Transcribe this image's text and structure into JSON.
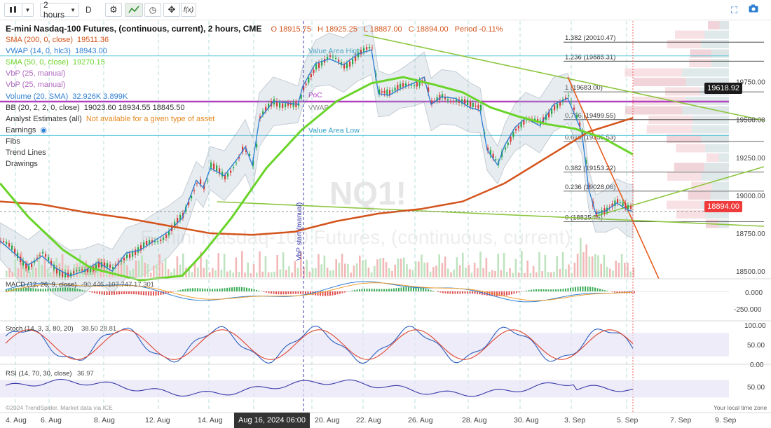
{
  "toolbar": {
    "interval": "2 hours",
    "d_label": "D"
  },
  "header": {
    "title": "E-mini Nasdaq-100 Futures, (continuous, current), 2 hours, CME",
    "open": "O 18915.75",
    "high": "H 18925.25",
    "low": "L 18887.00",
    "close": "C 18894.00",
    "period": "Period -0.11%"
  },
  "legend": [
    {
      "label": "SMA (200, 0, close)",
      "value": "19511.36",
      "color": "#d4541c"
    },
    {
      "label": "VWAP (14, 0, hlc3)",
      "value": "18943.00",
      "color": "#2d7dd2"
    },
    {
      "label": "SMA (50, 0, close)",
      "value": "19270.15",
      "color": "#6ad42a"
    },
    {
      "label": "VbP (25, manual)",
      "value": "",
      "color": "#b06bbf"
    },
    {
      "label": "VbP (25, manual)",
      "value": "",
      "color": "#b06bbf"
    },
    {
      "label": "Volume (20, SMA)",
      "value": "32.926K 3.899K",
      "color": "#2d7dd2"
    },
    {
      "label": "BB (20, 2, 2, 0, close)",
      "value": "19023.60 18934.55 18845.50",
      "color": "#333"
    },
    {
      "label": "Analyst Estimates (all)",
      "value": "Not available for a given type of asset",
      "color": "#333"
    },
    {
      "label": "Earnings",
      "value": "",
      "color": "#333"
    },
    {
      "label": "Fibs",
      "value": "",
      "color": "#333"
    },
    {
      "label": "Trend Lines",
      "value": "",
      "color": "#333"
    },
    {
      "label": "Drawings",
      "value": "",
      "color": "#333"
    }
  ],
  "annotations": {
    "value_area_high": "Value Area High",
    "value_area_low": "Value Area Low",
    "poc": "PoC",
    "vwap": "VWAP",
    "vbp_start": "VbP start (manual)",
    "watermark_symbol": "NQ1!",
    "watermark_name": "E-mini Nasdaq-100 Futures, (continuous, current)",
    "attribution": "©2024 TrendSpider. Market data via ICE",
    "timezone": "Your local time zone"
  },
  "fib_levels": [
    {
      "label": "1.382 (20010.47)",
      "price": 20010.47
    },
    {
      "label": "1.236 (19885.31)",
      "price": 19885.31
    },
    {
      "label": "1 (19683.00)",
      "price": 19683.0
    },
    {
      "label": "0.786 (19499.55)",
      "price": 19499.55
    },
    {
      "label": "0.618 (19355.53)",
      "price": 19355.53
    },
    {
      "label": "0.382 (19153.22)",
      "price": 19153.22
    },
    {
      "label": "0.236 (19028.06)",
      "price": 19028.06
    },
    {
      "label": "0 (18825.75)",
      "price": 18825.75
    }
  ],
  "price_tags": {
    "poc_price": "19618.92",
    "last_price": "18894.00"
  },
  "lower_panels": {
    "macd_label": "MACD (12, 26, 9, close)",
    "macd_values": "-90.446 -107.747 17.301",
    "stoch_label": "Stoch (14, 3, 3, 80, 20)",
    "stoch_values": "38.50 28.81",
    "rsi_label": "RSI (14, 70, 30, close)",
    "rsi_value": "36.97"
  },
  "time_highlight": "Aug 16, 2024 06:00",
  "chart_data": {
    "type": "candlestick",
    "price_axis": {
      "min": 18450,
      "max": 20150,
      "ticks": [
        18500,
        18750,
        19000,
        19250,
        19500,
        19750
      ]
    },
    "x_ticks": [
      "4. Aug",
      "6. Aug",
      "8. Aug",
      "12. Aug",
      "14. Aug",
      "20. Aug",
      "22. Aug",
      "26. Aug",
      "28. Aug",
      "30. Aug",
      "3. Sep",
      "5. Sep",
      "7. Sep",
      "9. Sep"
    ],
    "price_path": [
      [
        0,
        18700
      ],
      [
        20,
        18620
      ],
      [
        40,
        18540
      ],
      [
        60,
        18600
      ],
      [
        80,
        18520
      ],
      [
        100,
        18470
      ],
      [
        120,
        18500
      ],
      [
        140,
        18560
      ],
      [
        160,
        18500
      ],
      [
        180,
        18620
      ],
      [
        200,
        18640
      ],
      [
        220,
        18700
      ],
      [
        240,
        18760
      ],
      [
        260,
        18850
      ],
      [
        280,
        19100
      ],
      [
        290,
        19050
      ],
      [
        300,
        19180
      ],
      [
        320,
        19130
      ],
      [
        340,
        19250
      ],
      [
        350,
        19320
      ],
      [
        360,
        19200
      ],
      [
        370,
        19500
      ],
      [
        390,
        19620
      ],
      [
        410,
        19610
      ],
      [
        425,
        19600
      ],
      [
        432,
        19720
      ],
      [
        450,
        19870
      ],
      [
        470,
        19900
      ],
      [
        490,
        19860
      ],
      [
        510,
        19930
      ],
      [
        530,
        19960
      ],
      [
        540,
        19670
      ],
      [
        555,
        19660
      ],
      [
        570,
        19700
      ],
      [
        590,
        19740
      ],
      [
        605,
        19780
      ],
      [
        615,
        19600
      ],
      [
        630,
        19650
      ],
      [
        650,
        19640
      ],
      [
        670,
        19580
      ],
      [
        685,
        19560
      ],
      [
        695,
        19300
      ],
      [
        710,
        19200
      ],
      [
        720,
        19330
      ],
      [
        735,
        19450
      ],
      [
        750,
        19510
      ],
      [
        770,
        19460
      ],
      [
        790,
        19600
      ],
      [
        810,
        19640
      ],
      [
        830,
        19420
      ],
      [
        840,
        19040
      ],
      [
        850,
        18880
      ],
      [
        865,
        18900
      ],
      [
        880,
        18950
      ],
      [
        895,
        18905
      ],
      [
        903,
        18894
      ]
    ],
    "series": [
      {
        "name": "SMA (200, 0, close)",
        "color": "#d4541c",
        "points": [
          [
            0,
            18960
          ],
          [
            60,
            18940
          ],
          [
            120,
            18890
          ],
          [
            180,
            18850
          ],
          [
            240,
            18800
          ],
          [
            300,
            18750
          ],
          [
            360,
            18740
          ],
          [
            420,
            18760
          ],
          [
            480,
            18830
          ],
          [
            540,
            18880
          ],
          [
            600,
            18910
          ],
          [
            660,
            18960
          ],
          [
            720,
            19080
          ],
          [
            780,
            19250
          ],
          [
            840,
            19420
          ],
          [
            903,
            19511
          ]
        ]
      },
      {
        "name": "SMA (50, 0, close)",
        "color": "#6ad42a",
        "points": [
          [
            0,
            19080
          ],
          [
            40,
            18860
          ],
          [
            90,
            18640
          ],
          [
            130,
            18520
          ],
          [
            200,
            18440
          ],
          [
            260,
            18470
          ],
          [
            290,
            18620
          ],
          [
            330,
            18850
          ],
          [
            380,
            19180
          ],
          [
            430,
            19430
          ],
          [
            480,
            19620
          ],
          [
            530,
            19740
          ],
          [
            575,
            19780
          ],
          [
            620,
            19730
          ],
          [
            660,
            19680
          ],
          [
            700,
            19580
          ],
          [
            740,
            19520
          ],
          [
            780,
            19470
          ],
          [
            820,
            19440
          ],
          [
            860,
            19380
          ],
          [
            903,
            19270
          ]
        ]
      }
    ]
  }
}
